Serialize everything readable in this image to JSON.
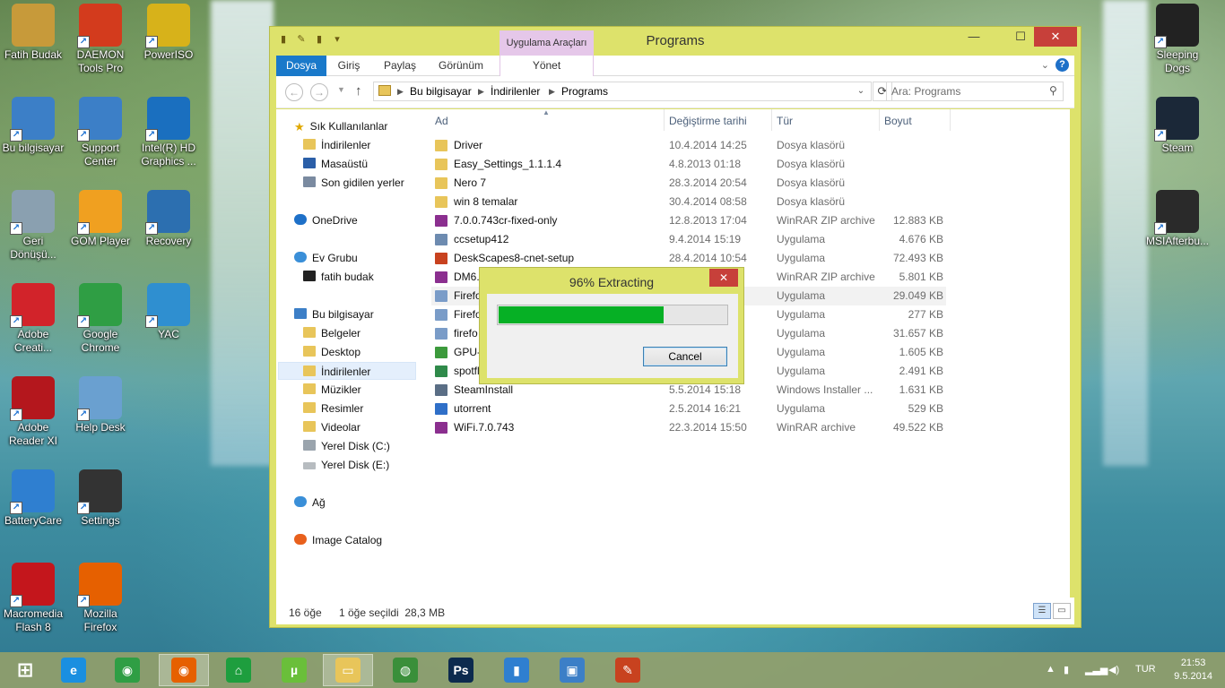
{
  "desktop": {
    "icons": [
      {
        "label": "Fatih Budak",
        "icon": "user-folder-icon",
        "color": "#c79a3a"
      },
      {
        "label": "DAEMON Tools Pro",
        "icon": "daemon-tools-icon",
        "color": "#d33b1d"
      },
      {
        "label": "PowerISO",
        "icon": "poweriso-icon",
        "color": "#d7b21a"
      },
      {
        "label": "Bu bilgisayar",
        "icon": "computer-icon",
        "color": "#3c7fc7"
      },
      {
        "label": "Support Center",
        "icon": "support-center-icon",
        "color": "#3c7fc7"
      },
      {
        "label": "Intel(R) HD Graphics ...",
        "icon": "intel-graphics-icon",
        "color": "#1a6fbf"
      },
      {
        "label": "Geri Dönüşü...",
        "icon": "recycle-bin-icon",
        "color": "#8aa0b0"
      },
      {
        "label": "GOM Player",
        "icon": "gom-player-icon",
        "color": "#f0a020"
      },
      {
        "label": "Recovery",
        "icon": "recovery-icon",
        "color": "#2c6fb0"
      },
      {
        "label": "Adobe Creati...",
        "icon": "adobe-cc-icon",
        "color": "#d2232a"
      },
      {
        "label": "Google Chrome",
        "icon": "chrome-icon",
        "color": "#2f9e44"
      },
      {
        "label": "YAC",
        "icon": "yac-shield-icon",
        "color": "#2f8fd0"
      },
      {
        "label": "Adobe Reader XI",
        "icon": "adobe-reader-icon",
        "color": "#b4171d"
      },
      {
        "label": "Help Desk",
        "icon": "help-desk-icon",
        "color": "#6aa0d0"
      },
      {
        "label": "BatteryCare",
        "icon": "battery-icon",
        "color": "#2f7fd0"
      },
      {
        "label": "Settings",
        "icon": "settings-knob-icon",
        "color": "#333333"
      },
      {
        "label": "Macromedia Flash 8",
        "icon": "flash-icon",
        "color": "#c4161c"
      },
      {
        "label": "Mozilla Firefox",
        "icon": "firefox-icon",
        "color": "#e66000"
      },
      {
        "label": "Sleeping Dogs",
        "icon": "sleeping-dogs-icon",
        "color": "#222222"
      },
      {
        "label": "Steam",
        "icon": "steam-icon",
        "color": "#1b2838"
      },
      {
        "label": "MSIAfterbu...",
        "icon": "msi-afterburner-icon",
        "color": "#2a2a2a"
      }
    ]
  },
  "window": {
    "title": "Programs",
    "tool_tab": "Uygulama Araçları",
    "ribbon_tabs": [
      "Dosya",
      "Giriş",
      "Paylaş",
      "Görünüm",
      "Yönet"
    ],
    "minimize": "—",
    "maximize": "☐",
    "close": "✕",
    "help": "?",
    "address": {
      "crumbs": [
        "Bu bilgisayar",
        "İndirilenler",
        "Programs"
      ]
    },
    "search_placeholder": "Ara: Programs",
    "nav": {
      "favorites": "Sık Kullanılanlar",
      "fav_items": [
        "İndirilenler",
        "Masaüstü",
        "Son gidilen yerler"
      ],
      "onedrive": "OneDrive",
      "homegroup": "Ev Grubu",
      "homegroup_user": "fatih budak",
      "this_pc": "Bu bilgisayar",
      "pc_items": [
        "Belgeler",
        "Desktop",
        "İndirilenler",
        "Müzikler",
        "Resimler",
        "Videolar",
        "Yerel Disk (C:)",
        "Yerel Disk (E:)"
      ],
      "network": "Ağ",
      "image_catalog": "Image Catalog"
    },
    "columns": {
      "name": "Ad",
      "date": "Değiştirme tarihi",
      "type": "Tür",
      "size": "Boyut"
    },
    "files": [
      {
        "name": "Driver",
        "date": "10.4.2014 14:25",
        "type": "Dosya klasörü",
        "size": "",
        "icon": "folder-icon"
      },
      {
        "name": "Easy_Settings_1.1.1.4",
        "date": "4.8.2013 01:18",
        "type": "Dosya klasörü",
        "size": "",
        "icon": "folder-icon"
      },
      {
        "name": "Nero 7",
        "date": "28.3.2014 20:54",
        "type": "Dosya klasörü",
        "size": "",
        "icon": "folder-icon"
      },
      {
        "name": "win 8 temalar",
        "date": "30.4.2014 08:58",
        "type": "Dosya klasörü",
        "size": "",
        "icon": "folder-icon"
      },
      {
        "name": "7.0.0.743cr-fixed-only",
        "date": "12.8.2013 17:04",
        "type": "WinRAR ZIP archive",
        "size": "12.883 KB",
        "icon": "winrar-icon"
      },
      {
        "name": "ccsetup412",
        "date": "9.4.2014 15:19",
        "type": "Uygulama",
        "size": "4.676 KB",
        "icon": "ccleaner-icon"
      },
      {
        "name": "DeskScapes8-cnet-setup",
        "date": "28.4.2014 10:54",
        "type": "Uygulama",
        "size": "72.493 KB",
        "icon": "deskscapes-icon"
      },
      {
        "name": "DM6.",
        "date": "",
        "type": "WinRAR ZIP archive",
        "size": "5.801 KB",
        "icon": "winrar-icon"
      },
      {
        "name": "Firefo",
        "date": "",
        "type": "Uygulama",
        "size": "29.049 KB",
        "icon": "installer-icon"
      },
      {
        "name": "Firefo",
        "date": "",
        "type": "Uygulama",
        "size": "277 KB",
        "icon": "installer-icon"
      },
      {
        "name": "firefo",
        "date": "",
        "type": "Uygulama",
        "size": "31.657 KB",
        "icon": "installer-icon"
      },
      {
        "name": "GPU-",
        "date": "",
        "type": "Uygulama",
        "size": "1.605 KB",
        "icon": "gpu-z-icon"
      },
      {
        "name": "spotfl",
        "date": "",
        "type": "Uygulama",
        "size": "2.491 KB",
        "icon": "spotflux-icon"
      },
      {
        "name": "SteamInstall",
        "date": "5.5.2014 15:18",
        "type": "Windows Installer ...",
        "size": "1.631 KB",
        "icon": "msi-installer-icon"
      },
      {
        "name": "utorrent",
        "date": "2.5.2014 16:21",
        "type": "Uygulama",
        "size": "529 KB",
        "icon": "utorrent-icon"
      },
      {
        "name": "WiFi.7.0.743",
        "date": "22.3.2014 15:50",
        "type": "WinRAR archive",
        "size": "49.522 KB",
        "icon": "winrar-icon"
      }
    ],
    "status": {
      "count": "16 öğe",
      "selected": "1 öğe seçildi  28,3 MB"
    }
  },
  "dialog": {
    "title": "96% Extracting",
    "close": "✕",
    "progress": 0.96,
    "cancel": "Cancel",
    "progress_color": "#06b025"
  },
  "taskbar": {
    "items": [
      "start-icon",
      "internet-explorer-icon",
      "chrome-icon",
      "firefox-icon",
      "store-icon",
      "utorrent-icon",
      "file-explorer-icon",
      "network-globe-icon",
      "photoshop-icon",
      "battery-care-icon",
      "winrar-box-icon",
      "tool-icon"
    ],
    "lang": "TUR",
    "time": "21:53",
    "date": "9.5.2014"
  },
  "colors": {
    "window_frame": "#dde26b",
    "ribbon_file_tab": "#1979ca",
    "close_button": "#c7403a",
    "tool_tab": "#e5c7e9"
  }
}
